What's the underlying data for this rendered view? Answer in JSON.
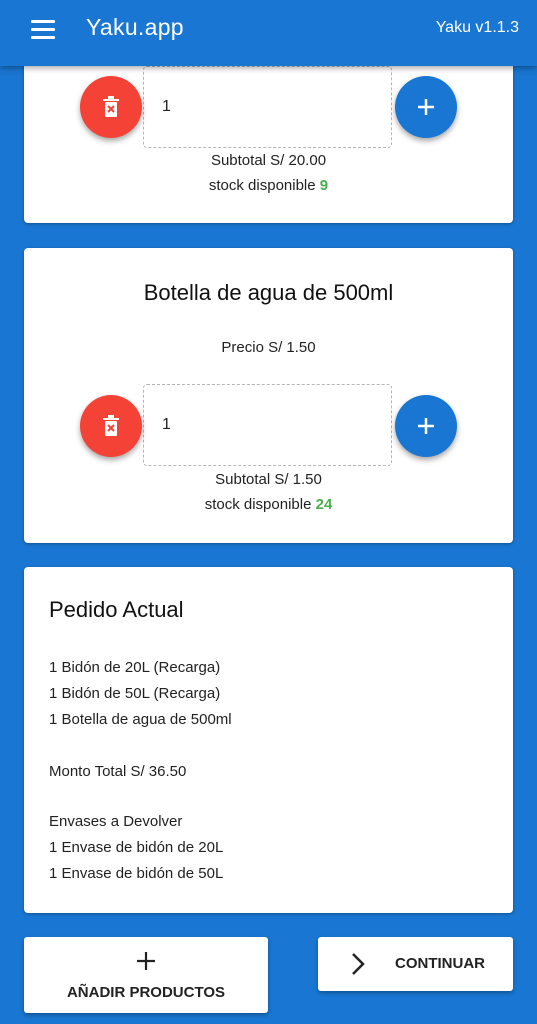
{
  "appbar": {
    "title": "Yaku.app",
    "version": "Yaku v1.1.3",
    "menu_icon": "menu-icon"
  },
  "product1": {
    "quantity": "1",
    "subtotal": "Subtotal S/ 20.00",
    "stock_label": "stock disponible",
    "stock_value": "9"
  },
  "product2": {
    "title": "Botella de agua de 500ml",
    "price": "Precio S/ 1.50",
    "quantity": "1",
    "subtotal": "Subtotal S/ 1.50",
    "stock_label": "stock disponible",
    "stock_value": "24"
  },
  "order": {
    "title": "Pedido Actual",
    "items": [
      "1 Bidón de 20L (Recarga)",
      "1 Bidón de 50L (Recarga)",
      "1 Botella de agua de 500ml"
    ],
    "total": "Monto Total S/ 36.50",
    "returns_title": "Envases a Devolver",
    "returns": [
      "1 Envase de bidón de 20L",
      "1 Envase de bidón de 50L"
    ]
  },
  "actions": {
    "add_label": "AÑADIR PRODUCTOS",
    "continue_label": "CONTINUAR"
  },
  "colors": {
    "primary": "#1976d2",
    "danger": "#f44336",
    "stock_green": "#4caf50"
  },
  "icons": [
    "menu-icon",
    "trash-icon",
    "plus-icon",
    "chevron-right-icon"
  ]
}
